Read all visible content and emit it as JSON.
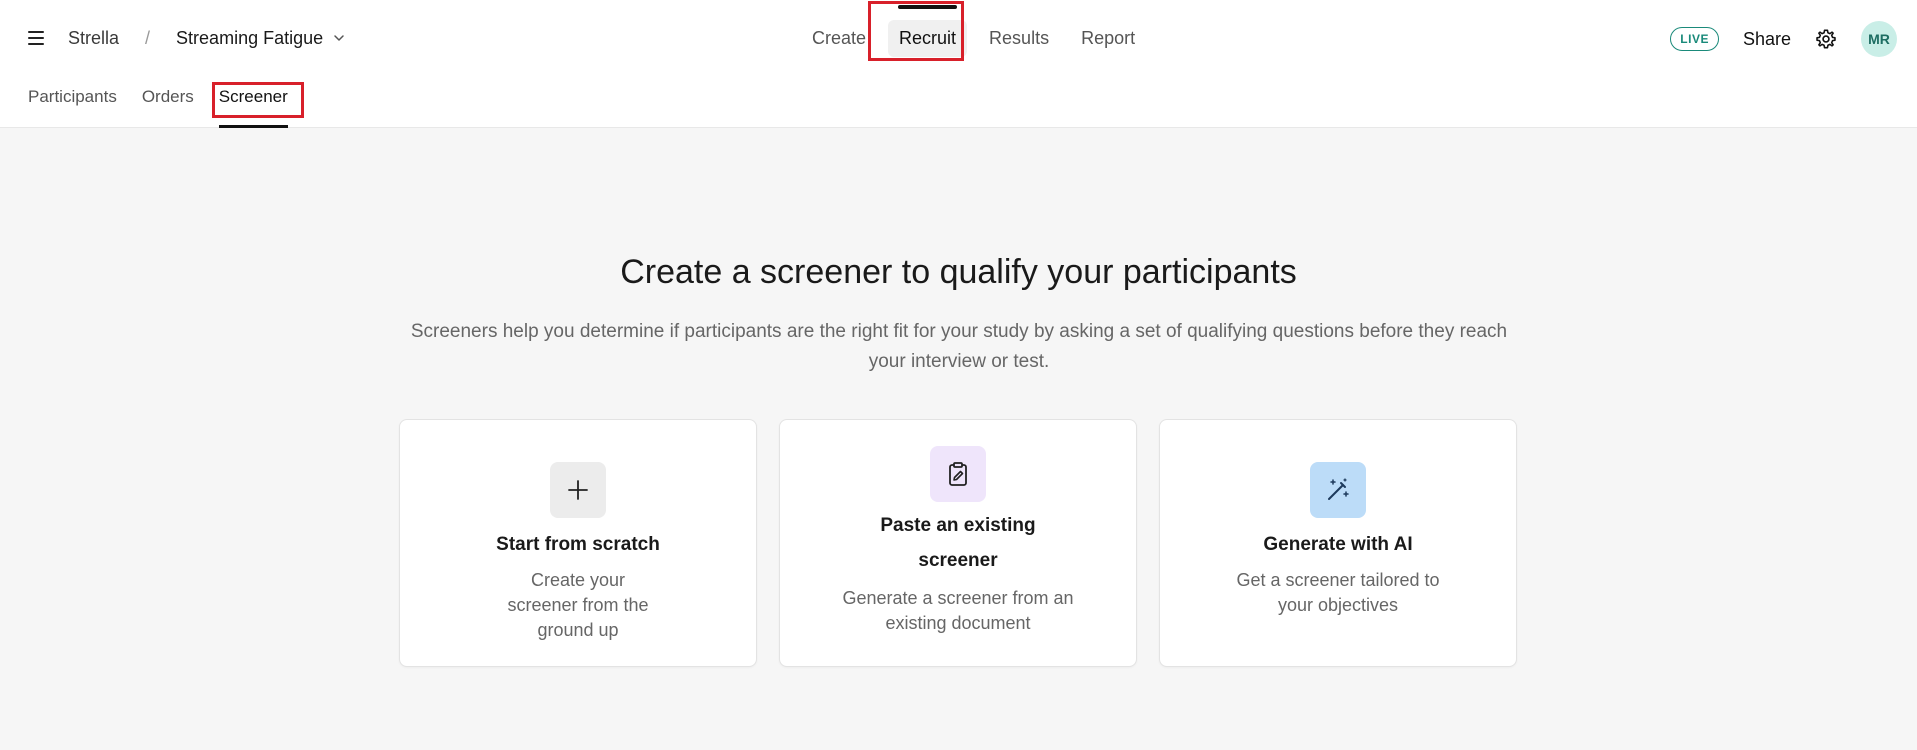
{
  "header": {
    "breadcrumb_root": "Strella",
    "breadcrumb_separator": "/",
    "study_name": "Streaming Fatigue",
    "live_badge": "LIVE",
    "share_label": "Share",
    "avatar_initials": "MR"
  },
  "topnav": {
    "create": "Create",
    "recruit": "Recruit",
    "results": "Results",
    "report": "Report"
  },
  "subnav": {
    "participants": "Participants",
    "orders": "Orders",
    "screener": "Screener"
  },
  "main": {
    "title": "Create a screener to qualify your participants",
    "description": "Screeners help you determine if participants are the right fit for your study by asking a set of qualifying questions before they reach your interview or test.",
    "cards": [
      {
        "title": "Start from scratch",
        "description": "Create your screener from the ground up",
        "icon": "plus-icon"
      },
      {
        "title": "Paste an existing screener",
        "description": "Generate a screener from an existing document",
        "icon": "clipboard-pencil-icon"
      },
      {
        "title": "Generate with AI",
        "description": "Get a screener tailored to your objectives",
        "icon": "magic-wand-icon"
      }
    ]
  },
  "colors": {
    "accent_live": "#1a8a7a",
    "highlight_box": "#d8202a",
    "avatar_bg": "#c9eee7",
    "ai_icon_bg": "#bcdcf8",
    "paste_icon_bg": "#efe5fb"
  }
}
